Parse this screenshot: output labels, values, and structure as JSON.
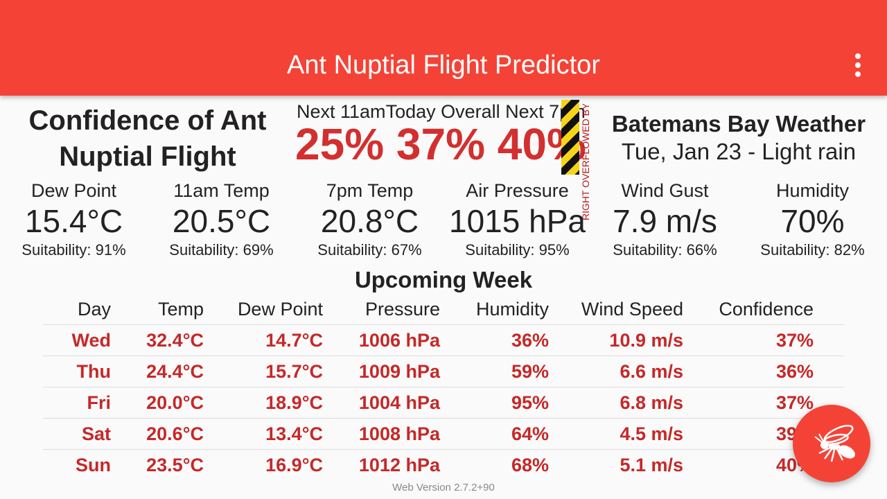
{
  "app_bar": {
    "title": "Ant Nuptial Flight Predictor",
    "menu_icon": "more-vert-icon"
  },
  "confidence": {
    "title": "Confidence of Ant Nuptial Flight",
    "labels": [
      "Next 11am",
      "Today Overall",
      "Next 7pm"
    ],
    "values": [
      "25%",
      "37%",
      "40%"
    ],
    "overflow_notice": "RIGHT OVERFLOWED BY 7..."
  },
  "weather": {
    "location": "Batemans Bay Weather",
    "date_condition": "Tue, Jan 23 - Light rain"
  },
  "metrics": [
    {
      "name": "Dew Point",
      "value": "15.4°C",
      "suitability": "Suitability: 91%"
    },
    {
      "name": "11am Temp",
      "value": "20.5°C",
      "suitability": "Suitability: 69%"
    },
    {
      "name": "7pm Temp",
      "value": "20.8°C",
      "suitability": "Suitability: 67%"
    },
    {
      "name": "Air Pressure",
      "value": "1015 hPa",
      "suitability": "Suitability: 95%"
    },
    {
      "name": "Wind Gust",
      "value": "7.9 m/s",
      "suitability": "Suitability: 66%"
    },
    {
      "name": "Humidity",
      "value": "70%",
      "suitability": "Suitability: 82%"
    }
  ],
  "week": {
    "title": "Upcoming Week",
    "columns": [
      "Day",
      "Temp",
      "Dew Point",
      "Pressure",
      "Humidity",
      "Wind Speed",
      "Confidence"
    ],
    "rows": [
      [
        "Wed",
        "32.4°C",
        "14.7°C",
        "1006 hPa",
        "36%",
        "10.9 m/s",
        "37%"
      ],
      [
        "Thu",
        "24.4°C",
        "15.7°C",
        "1009 hPa",
        "59%",
        "6.6 m/s",
        "36%"
      ],
      [
        "Fri",
        "20.0°C",
        "18.9°C",
        "1004 hPa",
        "95%",
        "6.8 m/s",
        "37%"
      ],
      [
        "Sat",
        "20.6°C",
        "13.4°C",
        "1008 hPa",
        "64%",
        "4.5 m/s",
        "39%"
      ],
      [
        "Sun",
        "23.5°C",
        "16.9°C",
        "1012 hPa",
        "68%",
        "5.1 m/s",
        "40%"
      ]
    ]
  },
  "footer": {
    "version": "Web Version 2.7.2+90"
  },
  "fab": {
    "icon": "ant-icon"
  },
  "colors": {
    "primary": "#f44336",
    "accent_text": "#d32f2f"
  }
}
